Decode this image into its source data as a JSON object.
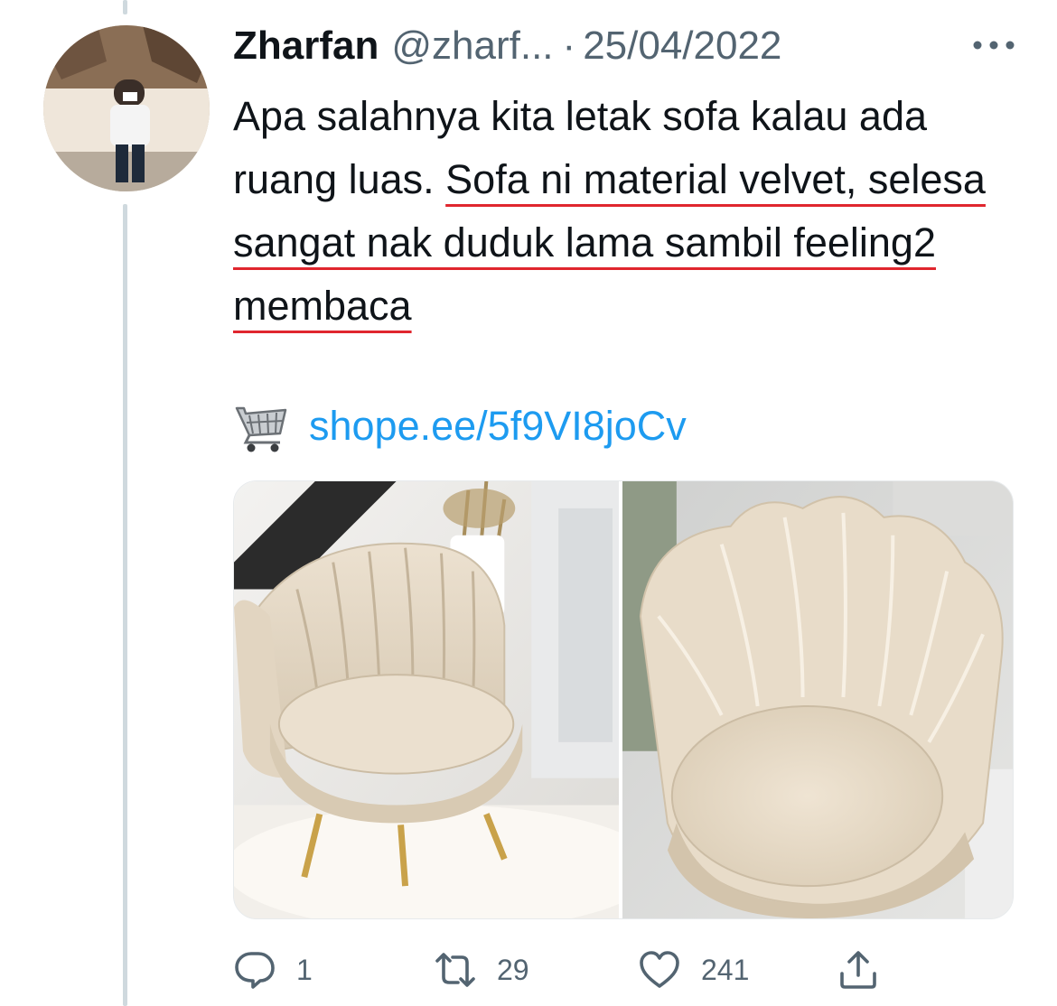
{
  "tweet": {
    "author": {
      "display_name": "Zharfan",
      "handle": "@zharf...",
      "avatar_icon": "user-avatar-photo"
    },
    "separator": "·",
    "date": "25/04/2022",
    "text": {
      "plain": "Apa salahnya kita letak sofa kalau ada ruang luas. ",
      "underlined": "Sofa ni material velvet, selesa sangat nak duduk lama sambil feeling2 membaca"
    },
    "link": {
      "emoji_icon": "shopping-cart-icon",
      "text": "shope.ee/5f9VI8joCv"
    },
    "media": {
      "photos": [
        {
          "icon": "velvet-shell-armchair-photo"
        },
        {
          "icon": "velvet-shell-armchair-closeup-photo"
        }
      ]
    },
    "stats": {
      "replies": "1",
      "retweets": "29",
      "likes": "241"
    }
  },
  "colors": {
    "link": "#1d9bf0",
    "secondary_text": "#536471",
    "underline_annotation": "#e0262e",
    "thread_line": "#cfd9de"
  }
}
